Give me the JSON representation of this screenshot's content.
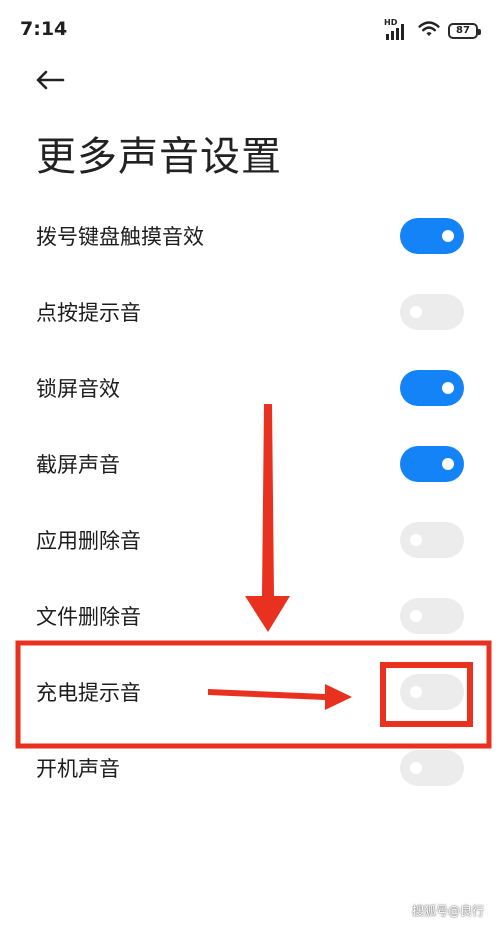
{
  "status_bar": {
    "time": "7:14",
    "hd_label": "HD",
    "battery_level": "87"
  },
  "header": {
    "back_icon": "arrow-left-icon",
    "title": "更多声音设置"
  },
  "settings": [
    {
      "label": "拨号键盘触摸音效",
      "enabled": true
    },
    {
      "label": "点按提示音",
      "enabled": false
    },
    {
      "label": "锁屏音效",
      "enabled": true
    },
    {
      "label": "截屏声音",
      "enabled": true
    },
    {
      "label": "应用删除音",
      "enabled": false
    },
    {
      "label": "文件删除音",
      "enabled": false
    },
    {
      "label": "充电提示音",
      "enabled": false
    },
    {
      "label": "开机声音",
      "enabled": false
    }
  ],
  "colors": {
    "toggle_on": "#1583f8",
    "toggle_off": "#ececec",
    "annotation_red": "#e8311f"
  },
  "watermark": "搜狐号@良行"
}
